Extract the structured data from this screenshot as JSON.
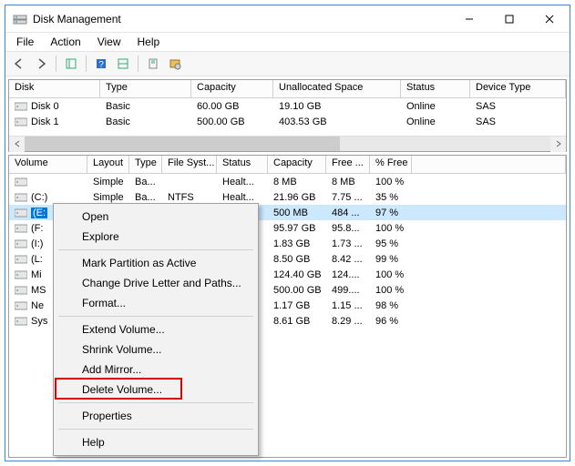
{
  "window": {
    "title": "Disk Management"
  },
  "menubar": [
    "File",
    "Action",
    "View",
    "Help"
  ],
  "disk_table": {
    "headers": [
      "Disk",
      "Type",
      "Capacity",
      "Unallocated Space",
      "Status",
      "Device Type"
    ],
    "rows": [
      {
        "name": "Disk 0",
        "type": "Basic",
        "capacity": "60.00 GB",
        "unallocated": "19.10 GB",
        "status": "Online",
        "device": "SAS"
      },
      {
        "name": "Disk 1",
        "type": "Basic",
        "capacity": "500.00 GB",
        "unallocated": "403.53 GB",
        "status": "Online",
        "device": "SAS"
      }
    ]
  },
  "volume_table": {
    "headers": [
      "Volume",
      "Layout",
      "Type",
      "File Syst...",
      "Status",
      "Capacity",
      "Free ...",
      "% Free",
      ""
    ],
    "rows": [
      {
        "name": "",
        "layout": "Simple",
        "type": "Ba...",
        "fs": "",
        "status": "Healt...",
        "capacity": "8 MB",
        "free": "8 MB",
        "pct": "100 %"
      },
      {
        "name": "(C:)",
        "layout": "Simple",
        "type": "Ba...",
        "fs": "NTFS",
        "status": "Healt...",
        "capacity": "21.96 GB",
        "free": "7.75 ...",
        "pct": "35 %"
      },
      {
        "name": "(E:",
        "layout": "",
        "type": "",
        "fs": "",
        "status": "",
        "capacity": "500 MB",
        "free": "484 ...",
        "pct": "97 %",
        "selected": true
      },
      {
        "name": "(F:",
        "layout": "",
        "type": "",
        "fs": "",
        "status": "",
        "capacity": "95.97 GB",
        "free": "95.8...",
        "pct": "100 %"
      },
      {
        "name": "(I:)",
        "layout": "",
        "type": "",
        "fs": "",
        "status": "",
        "capacity": "1.83 GB",
        "free": "1.73 ...",
        "pct": "95 %"
      },
      {
        "name": "(L:",
        "layout": "",
        "type": "",
        "fs": "",
        "status": "",
        "capacity": "8.50 GB",
        "free": "8.42 ...",
        "pct": "99 %"
      },
      {
        "name": "Mi",
        "layout": "",
        "type": "",
        "fs": "",
        "status": "",
        "capacity": "124.40 GB",
        "free": "124....",
        "pct": "100 %"
      },
      {
        "name": "MS",
        "layout": "",
        "type": "",
        "fs": "",
        "status": "",
        "capacity": "500.00 GB",
        "free": "499....",
        "pct": "100 %"
      },
      {
        "name": "Ne",
        "layout": "",
        "type": "",
        "fs": "",
        "status": "",
        "capacity": "1.17 GB",
        "free": "1.15 ...",
        "pct": "98 %"
      },
      {
        "name": "Sys",
        "layout": "",
        "type": "",
        "fs": "",
        "status": "",
        "capacity": "8.61 GB",
        "free": "8.29 ...",
        "pct": "96 %"
      }
    ]
  },
  "context_menu": {
    "groups": [
      [
        "Open",
        "Explore"
      ],
      [
        "Mark Partition as Active",
        "Change Drive Letter and Paths...",
        "Format..."
      ],
      [
        "Extend Volume...",
        "Shrink Volume...",
        "Add Mirror...",
        "Delete Volume..."
      ],
      [
        "Properties"
      ],
      [
        "Help"
      ]
    ],
    "highlighted": "Delete Volume..."
  }
}
